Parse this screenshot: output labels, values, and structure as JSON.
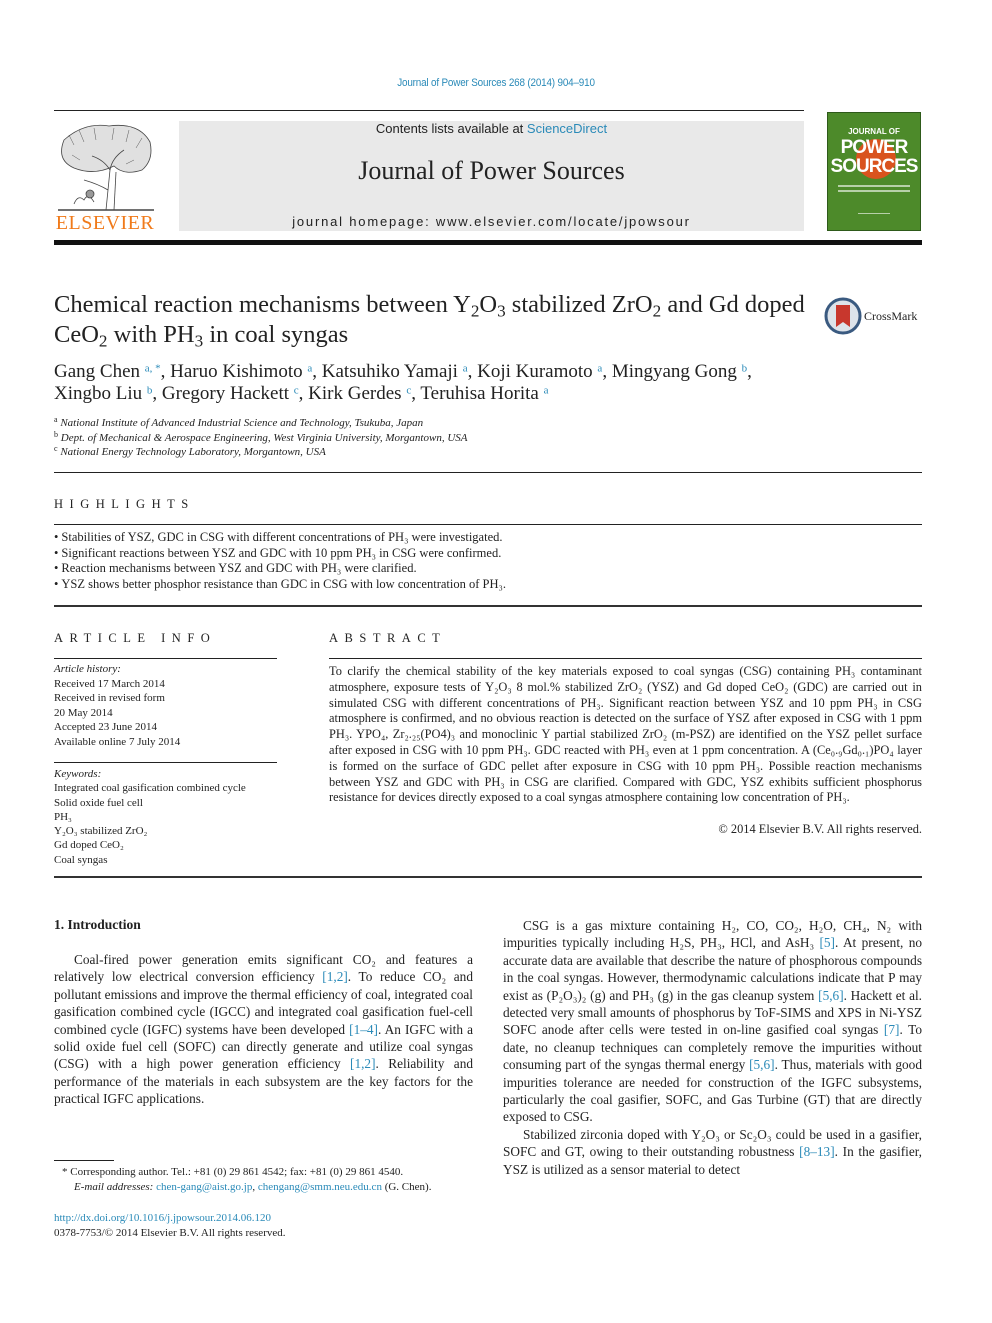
{
  "header": {
    "citation": "Journal of Power Sources 268 (2014) 904–910",
    "contents_prefix": "Contents lists available at ",
    "contents_link": "ScienceDirect",
    "journal_name": "Journal of Power Sources",
    "homepage": "journal homepage: www.elsevier.com/locate/jpowsour",
    "publisher": "ELSEVIER",
    "cover": {
      "line1": "JOURNAL OF",
      "line2": "POWER",
      "line3": "SOURCES",
      "bg_color": "#4d8a2a",
      "accent_color": "#d9531e"
    },
    "crossmark_label": "CrossMark",
    "publisher_color": "#f07a1a",
    "link_color": "#2a8ab8"
  },
  "article": {
    "title_parts": [
      "Chemical reaction mechanisms between Y",
      "2",
      "O",
      "3",
      " stabilized ZrO",
      "2",
      " and Gd doped CeO",
      "2",
      " with PH",
      "3",
      " in coal syngas"
    ],
    "authors": [
      {
        "name": "Gang Chen",
        "aff": "a, *"
      },
      {
        "name": "Haruo Kishimoto",
        "aff": "a"
      },
      {
        "name": "Katsuhiko Yamaji",
        "aff": "a"
      },
      {
        "name": "Koji Kuramoto",
        "aff": "a"
      },
      {
        "name": "Mingyang Gong",
        "aff": "b"
      },
      {
        "name": "Xingbo Liu",
        "aff": "b"
      },
      {
        "name": "Gregory Hackett",
        "aff": "c"
      },
      {
        "name": "Kirk Gerdes",
        "aff": "c"
      },
      {
        "name": "Teruhisa Horita",
        "aff": "a"
      }
    ],
    "affiliations": [
      {
        "key": "a",
        "text": "National Institute of Advanced Industrial Science and Technology, Tsukuba, Japan"
      },
      {
        "key": "b",
        "text": "Dept. of Mechanical & Aerospace Engineering, West Virginia University, Morgantown, USA"
      },
      {
        "key": "c",
        "text": "National Energy Technology Laboratory, Morgantown, USA"
      }
    ]
  },
  "highlights": {
    "heading": "HIGHLIGHTS",
    "items": [
      "Stabilities of YSZ, GDC in CSG with different concentrations of PH₃ were investigated.",
      "Significant reactions between YSZ and GDC with 10 ppm PH₃ in CSG were confirmed.",
      "Reaction mechanisms between YSZ and GDC with PH₃ were clarified.",
      "YSZ shows better phosphor resistance than GDC in CSG with low concentration of PH₃."
    ]
  },
  "article_info": {
    "heading": "ARTICLE INFO",
    "history_label": "Article history:",
    "history": [
      "Received 17 March 2014",
      "Received in revised form",
      "20 May 2014",
      "Accepted 23 June 2014",
      "Available online 7 July 2014"
    ],
    "keywords_label": "Keywords:",
    "keywords": [
      "Integrated coal gasification combined cycle",
      "Solid oxide fuel cell",
      "PH₃",
      "Y₂O₃ stabilized ZrO₂",
      "Gd doped CeO₂",
      "Coal syngas"
    ]
  },
  "abstract": {
    "heading": "ABSTRACT",
    "text": "To clarify the chemical stability of the key materials exposed to coal syngas (CSG) containing PH₃ contaminant atmosphere, exposure tests of Y₂O₃ 8 mol.% stabilized ZrO₂ (YSZ) and Gd doped CeO₂ (GDC) are carried out in simulated CSG with different concentrations of PH₃. Significant reaction between YSZ and 10 ppm PH₃ in CSG atmosphere is confirmed, and no obvious reaction is detected on the surface of YSZ after exposed in CSG with 1 ppm PH₃. YPO₄, Zr₂.₂₅(PO4)₃ and monoclinic Y partial stabilized ZrO₂ (m-PSZ) are identified on the YSZ pellet surface after exposed in CSG with 10 ppm PH₃. GDC reacted with PH₃ even at 1 ppm concentration. A (Ce₀.₉Gd₀.₁)PO₄ layer is formed on the surface of GDC pellet after exposure in CSG with 10 ppm PH₃. Possible reaction mechanisms between YSZ and GDC with PH₃ in CSG are clarified. Compared with GDC, YSZ exhibits sufficient phosphorus resistance for devices directly exposed to a coal syngas atmosphere containing low concentration of PH₃.",
    "copyright": "© 2014 Elsevier B.V. All rights reserved."
  },
  "intro": {
    "heading": "1.  Introduction",
    "left_paragraphs": [
      [
        {
          "t": "Coal-fired power generation emits significant CO₂ and features a relatively low electrical conversion efficiency "
        },
        {
          "ref": "[1,2]"
        },
        {
          "t": ". To reduce CO₂ and pollutant emissions and improve the thermal efficiency of coal, integrated coal gasification combined cycle (IGCC) and integrated coal gasification fuel-cell combined cycle (IGFC) systems have been developed "
        },
        {
          "ref": "[1–4]"
        },
        {
          "t": ". An IGFC with a solid oxide fuel cell (SOFC) can directly generate and utilize coal syngas (CSG) with a high power generation efficiency "
        },
        {
          "ref": "[1,2]"
        },
        {
          "t": ". Reliability and performance of the materials in each subsystem are the key factors for the practical IGFC applications."
        }
      ]
    ],
    "right_paragraphs": [
      [
        {
          "t": "CSG is a gas mixture containing H₂, CO, CO₂, H₂O, CH₄, N₂ with impurities typically including H₂S, PH₃, HCl, and AsH₃ "
        },
        {
          "ref": "[5]"
        },
        {
          "t": ". At present, no accurate data are available that describe the nature of phosphorous compounds in the coal syngas. However, thermodynamic calculations indicate that P may exist as (P₂O₃)₂ (g) and PH₃ (g) in the gas cleanup system "
        },
        {
          "ref": "[5,6]"
        },
        {
          "t": ". Hackett et al. detected very small amounts of phosphorus by ToF-SIMS and XPS in Ni-YSZ SOFC anode after cells were tested in on-line gasified coal syngas "
        },
        {
          "ref": "[7]"
        },
        {
          "t": ". To date, no cleanup techniques can completely remove the impurities without consuming part of the syngas thermal energy "
        },
        {
          "ref": "[5,6]"
        },
        {
          "t": ". Thus, materials with good impurities tolerance are needed for construction of the IGFC subsystems, particularly the coal gasifier, SOFC, and Gas Turbine (GT) that are directly exposed to CSG."
        }
      ],
      [
        {
          "t": "Stabilized zirconia doped with Y₂O₃ or Sc₂O₃ could be used in a gasifier, SOFC and GT, owing to their outstanding robustness "
        },
        {
          "ref": "[8–13]"
        },
        {
          "t": ". In the gasifier, YSZ is utilized as a sensor material to detect"
        }
      ]
    ]
  },
  "footnote": {
    "corresponding": "* Corresponding author. Tel.: +81 (0) 29 861 4542; fax: +81 (0) 29 861 4540.",
    "email_label": "E-mail addresses: ",
    "emails": [
      "chen-gang@aist.go.jp",
      "chengang@smm.neu.edu.cn"
    ],
    "email_suffix": " (G. Chen).",
    "doi": "http://dx.doi.org/10.1016/j.jpowsour.2014.06.120",
    "issn": "0378-7753/© 2014 Elsevier B.V. All rights reserved."
  }
}
